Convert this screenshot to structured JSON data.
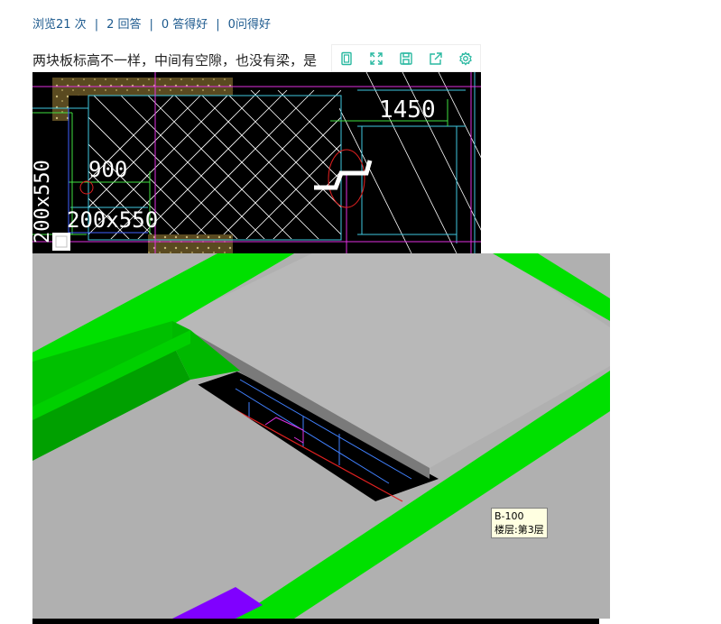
{
  "stats": {
    "views": "浏览21 次",
    "answers": "2 回答",
    "good_answers": "0 答得好",
    "good_questions": "0问得好",
    "separator": "|"
  },
  "question": {
    "text": "两块板标高不一样，中间有空隙，也没有梁，是"
  },
  "toolbar": {
    "icons": [
      "frame-icon",
      "fullscreen-icon",
      "save-icon",
      "share-icon",
      "settings-icon"
    ]
  },
  "cad": {
    "dim_1450": "1450",
    "dim_900": "900",
    "beam_label": "200x550",
    "beam_label_vertical": "200x550"
  },
  "model": {
    "tooltip_line1": "B-100",
    "tooltip_line2": "楼层:第3层"
  },
  "colors": {
    "link": "#1d5a8e",
    "beam_green": "#00e000",
    "slab_gray": "#b0b0b0",
    "purple": "#8000ff"
  }
}
